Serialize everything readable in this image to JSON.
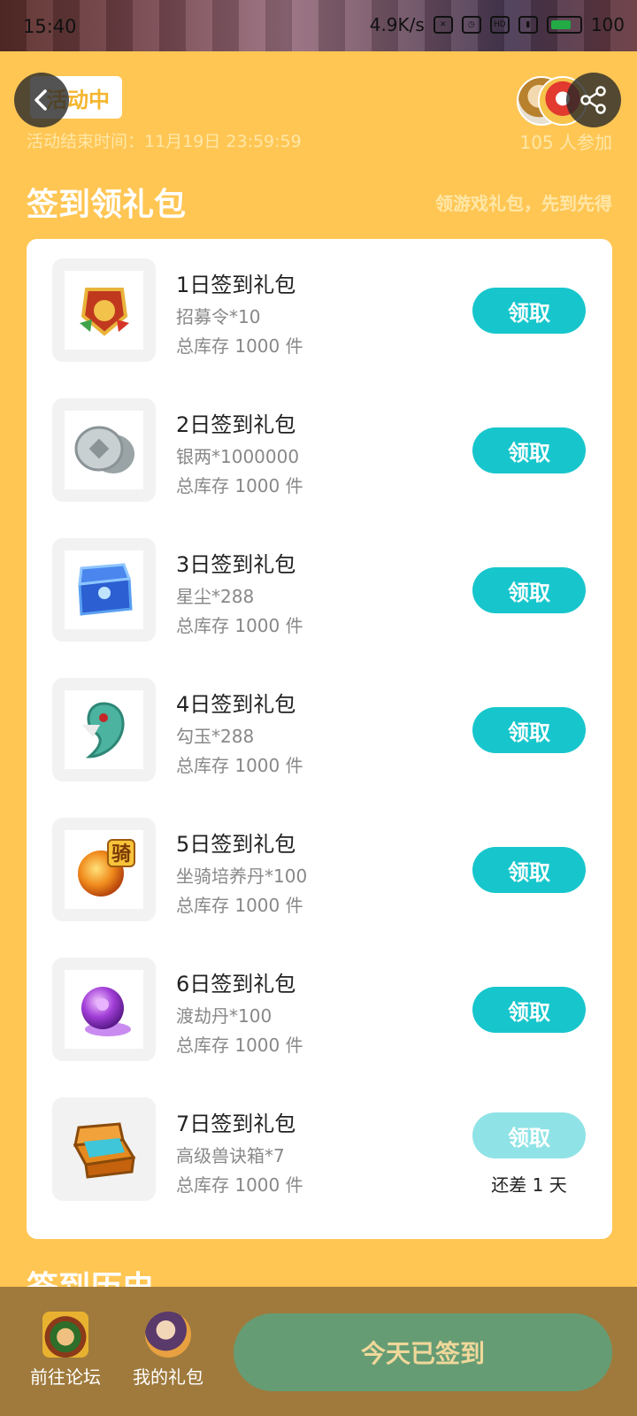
{
  "status_bar": {
    "time": "15:40",
    "net_speed": "4.9K/s",
    "battery": "100"
  },
  "header": {
    "status_tag": "活动中",
    "end_time": "活动结束时间：11月19日 23:59:59",
    "participants": "105 人参加"
  },
  "section": {
    "title": "签到领礼包",
    "subtitle": "领游戏礼包，先到先得"
  },
  "gifts": [
    {
      "name": "1日签到礼包",
      "desc": "招募令*10",
      "stock": "总库存 1000 件",
      "button": "领取",
      "icon": "recruit-token-icon",
      "enabled": true
    },
    {
      "name": "2日签到礼包",
      "desc": "银两*1000000",
      "stock": "总库存 1000 件",
      "button": "领取",
      "icon": "silver-coin-icon",
      "enabled": true
    },
    {
      "name": "3日签到礼包",
      "desc": "星尘*288",
      "stock": "总库存 1000 件",
      "button": "领取",
      "icon": "stardust-chest-icon",
      "enabled": true
    },
    {
      "name": "4日签到礼包",
      "desc": "勾玉*288",
      "stock": "总库存 1000 件",
      "button": "领取",
      "icon": "jade-magatama-icon",
      "enabled": true
    },
    {
      "name": "5日签到礼包",
      "desc": "坐骑培养丹*100",
      "stock": "总库存 1000 件",
      "button": "领取",
      "icon": "mount-pill-icon",
      "badge": "骑",
      "enabled": true
    },
    {
      "name": "6日签到礼包",
      "desc": "渡劫丹*100",
      "stock": "总库存 1000 件",
      "button": "领取",
      "icon": "purple-orb-icon",
      "enabled": true
    },
    {
      "name": "7日签到礼包",
      "desc": "高级兽诀箱*7",
      "stock": "总库存 1000 件",
      "button": "领取",
      "icon": "treasure-chest-icon",
      "remain": "还差 1 天",
      "enabled": false
    }
  ],
  "history": {
    "title": "签到历史"
  },
  "bottom_bar": {
    "forum_label": "前往论坛",
    "my_gifts_label": "我的礼包",
    "signed_label": "今天已签到"
  },
  "colors": {
    "background": "#FFC654",
    "accent": "#17C6CC",
    "signed": "#669C74"
  }
}
